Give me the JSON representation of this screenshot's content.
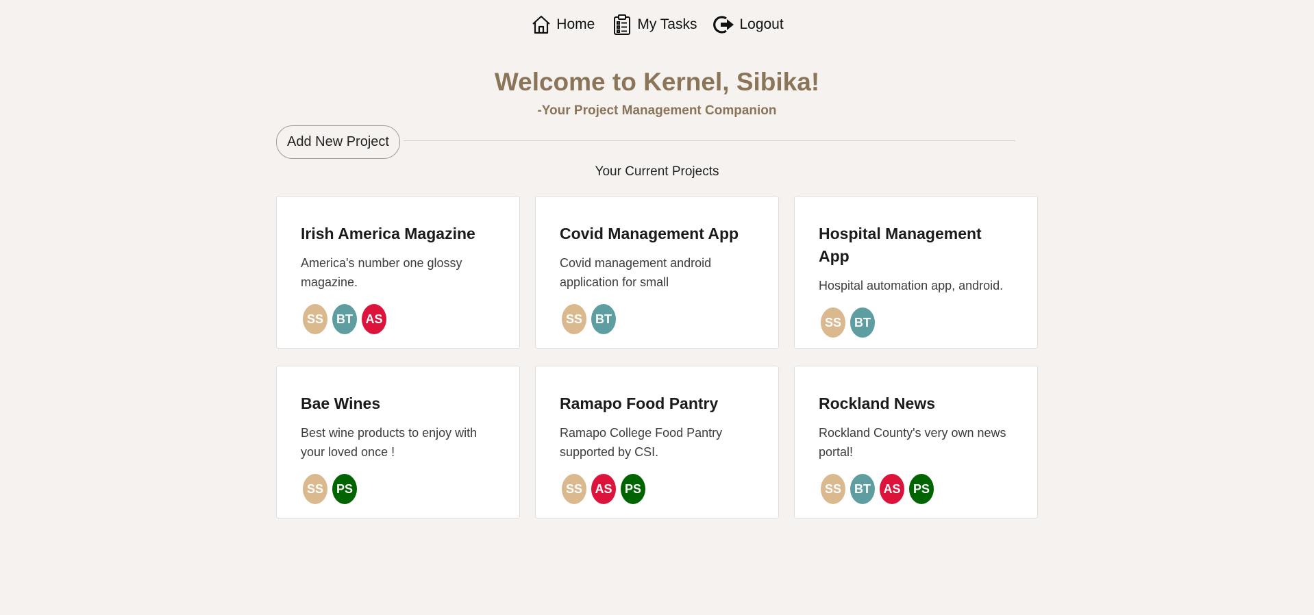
{
  "nav": {
    "home_label": "Home",
    "tasks_label": "My Tasks",
    "logout_label": "Logout"
  },
  "header": {
    "welcome": "Welcome to Kernel, Sibika!",
    "subtitle": "-Your Project Management Companion"
  },
  "actions": {
    "add_project_label": "Add New Project"
  },
  "section_title": "Your Current Projects",
  "colors": {
    "SS": "#dbb98e",
    "BT": "#5f9ea0",
    "AS": "#dc143c",
    "PS": "#006400"
  },
  "projects": [
    {
      "title": "Irish America Magazine",
      "desc": "America's number one glossy magazine.",
      "members": [
        "SS",
        "BT",
        "AS"
      ]
    },
    {
      "title": "Covid Management App",
      "desc": "Covid management android application for small",
      "members": [
        "SS",
        "BT"
      ]
    },
    {
      "title": "Hospital Management App",
      "desc": "Hospital automation app, android.",
      "members": [
        "SS",
        "BT"
      ]
    },
    {
      "title": "Bae Wines",
      "desc": "Best wine products to enjoy with your loved once !",
      "members": [
        "SS",
        "PS"
      ]
    },
    {
      "title": "Ramapo Food Pantry",
      "desc": "Ramapo College Food Pantry supported by CSI.",
      "members": [
        "SS",
        "AS",
        "PS"
      ]
    },
    {
      "title": "Rockland News",
      "desc": "Rockland County's very own news portal!",
      "members": [
        "SS",
        "BT",
        "AS",
        "PS"
      ]
    }
  ]
}
